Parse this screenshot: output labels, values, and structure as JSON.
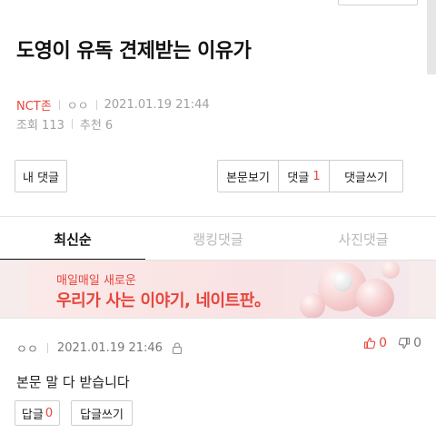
{
  "post": {
    "title": "도영이 유독 견제받는 이유가",
    "board": "NCT존",
    "author": "ㅇㅇ",
    "date": "2021.01.19 21:44",
    "views_label": "조회 113",
    "recommend_label": "추천 6"
  },
  "actions": {
    "my_comments": "내 댓글",
    "view_post": "본문보기",
    "comments_label": "댓글",
    "comments_count": "1",
    "write_comment": "댓글쓰기"
  },
  "tabs": [
    {
      "label": "최신순",
      "active": true
    },
    {
      "label": "랭킹댓글",
      "active": false
    },
    {
      "label": "사진댓글",
      "active": false
    }
  ],
  "banner": {
    "line1": "매일매일 새로운",
    "line2": "우리가 사는 이야기, 네이트판。"
  },
  "comment": {
    "author": "ㅇㅇ",
    "date": "2021.01.19 21:46",
    "likes": "0",
    "dislikes": "0",
    "body": "본문 말 다 받습니다",
    "reply_label": "답글",
    "reply_count": "0",
    "write_reply": "답글쓰기"
  },
  "colors": {
    "accent": "#e6463c",
    "banner_bg": "#f6ecec"
  }
}
